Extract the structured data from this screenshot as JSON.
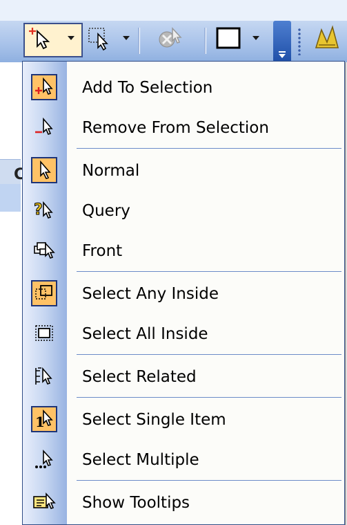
{
  "toolbar": {
    "buttons": [
      {
        "icon": "add-to-selection-icon",
        "has_dropdown": true,
        "active": true
      },
      {
        "icon": "select-rectangle-icon",
        "has_dropdown": true
      },
      {
        "icon": "clear-selection-icon",
        "has_dropdown": false,
        "disabled": true
      },
      {
        "icon": "frame-rectangle-icon",
        "has_dropdown": true
      },
      {
        "icon": "overflow-icon",
        "has_dropdown": true
      },
      {
        "icon": "yellow-tool-icon",
        "has_dropdown": false
      }
    ]
  },
  "menu": {
    "items": [
      {
        "label": "Add To Selection",
        "icon": "add-to-selection-icon",
        "checked": true
      },
      {
        "label": "Remove From Selection",
        "icon": "remove-from-selection-icon",
        "checked": false
      },
      {
        "label": "Normal",
        "icon": "normal-pointer-icon",
        "checked": true
      },
      {
        "label": "Query",
        "icon": "query-pointer-icon",
        "checked": false
      },
      {
        "label": "Front",
        "icon": "front-pointer-icon",
        "checked": false
      },
      {
        "label": "Select Any Inside",
        "icon": "select-any-inside-icon",
        "checked": true
      },
      {
        "label": "Select All Inside",
        "icon": "select-all-inside-icon",
        "checked": false
      },
      {
        "label": "Select Related",
        "icon": "select-related-icon",
        "checked": false
      },
      {
        "label": "Select Single Item",
        "icon": "select-single-item-icon",
        "checked": true
      },
      {
        "label": "Select Multiple",
        "icon": "select-multiple-icon",
        "checked": false
      },
      {
        "label": "Show Tooltips",
        "icon": "show-tooltips-icon",
        "checked": false
      }
    ]
  },
  "colors": {
    "menu_border": "#2e4c86",
    "checked_fill": "#ffc266",
    "checked_border": "#1d3478",
    "gutter_dark": "#98b3e2"
  }
}
